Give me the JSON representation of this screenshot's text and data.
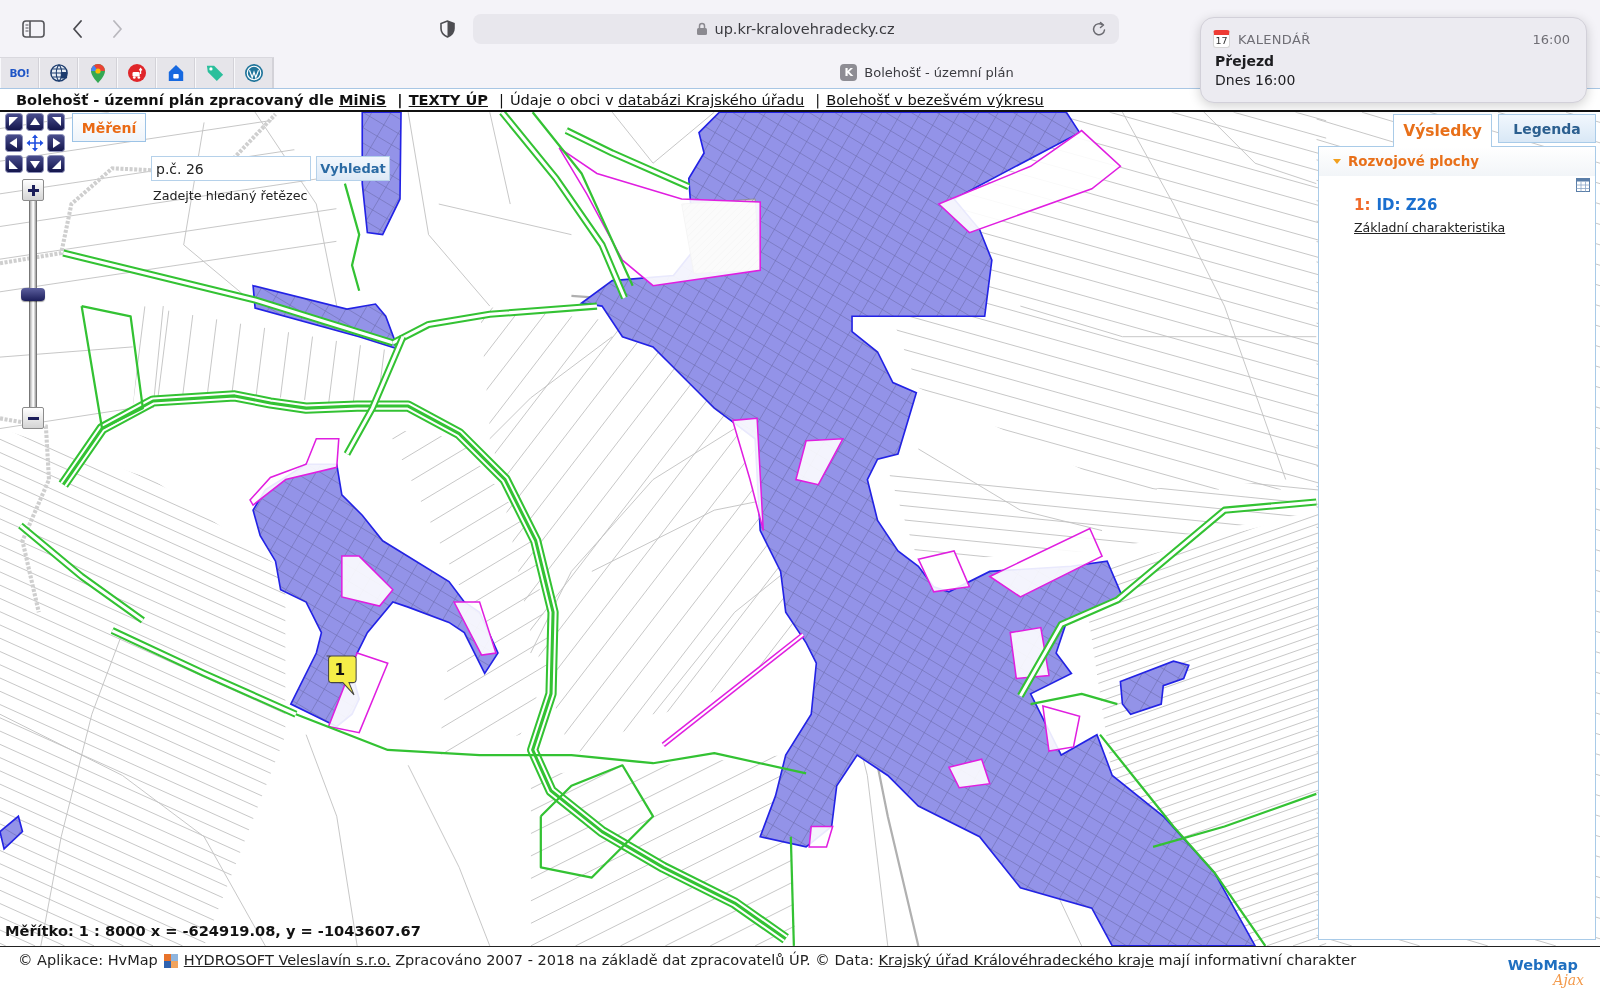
{
  "browser": {
    "nav": [
      {
        "kind": "back",
        "disabled": false
      },
      {
        "kind": "forward",
        "disabled": true
      }
    ],
    "url": "up.kr-kralovehradecky.cz",
    "favorites": [
      {
        "kind": "text",
        "label": "BO!"
      },
      {
        "kind": "globe"
      },
      {
        "kind": "pin"
      },
      {
        "kind": "badge"
      },
      {
        "kind": "house"
      },
      {
        "kind": "tag"
      },
      {
        "kind": "circle"
      }
    ],
    "tab": {
      "icon_letter": "K",
      "title": "Bolehošť - územní plán"
    }
  },
  "notification": {
    "day": "17",
    "app": "KALENDÁŘ",
    "time": "16:00",
    "title": "Přejezd",
    "body": "Dnes 16:00"
  },
  "header": {
    "items": [
      {
        "text": "Bolehošť - územní plán zpracovaný dle",
        "link": "MiNiS",
        "bold": true
      },
      {
        "separator": "|",
        "link": "TEXTY ÚP",
        "bold": true
      },
      {
        "separator": "|",
        "text": "Údaje o obci v",
        "link": "databázi Krajského úřadu",
        "bold": false
      },
      {
        "separator": "|",
        "link": "Bolehošť v bezešvém výkresu",
        "bold": false
      }
    ]
  },
  "map": {
    "measure_button": "Měření",
    "search": {
      "value": "p.č. 26",
      "button": "Vyhledat",
      "hint": "Zadejte hledaný řetězec"
    },
    "zoom": {
      "level": 0.55
    },
    "marker": "1",
    "scale_line": "Měřítko: 1 : 8000 x = -624919.08, y = -1043607.67"
  },
  "results_panel": {
    "tabs": [
      {
        "label": "Výsledky",
        "selected": true
      },
      {
        "label": "Legenda",
        "selected": false
      }
    ],
    "section": {
      "title": "Rozvojové plochy",
      "expanded": true,
      "results": [
        {
          "number": "1:",
          "id": "ID: Z26",
          "link": "Základní charakteristika"
        }
      ]
    }
  },
  "footer": {
    "lead": "© Aplikace: HvMap",
    "parts": [
      {
        "kind": "link",
        "text": "HYDROSOFT Veleslavín s.r.o."
      },
      {
        "kind": "text",
        "text": "Zpracováno 2007 - 2018 na základě dat zpracovatelů ÚP. © Data:"
      },
      {
        "kind": "link",
        "text": "Krajský úřad Královéhradeckého kraje"
      },
      {
        "kind": "text",
        "text": "mají informativní charakter"
      }
    ],
    "logo": {
      "title": "WebMap",
      "subtitle": "Ajax"
    }
  }
}
